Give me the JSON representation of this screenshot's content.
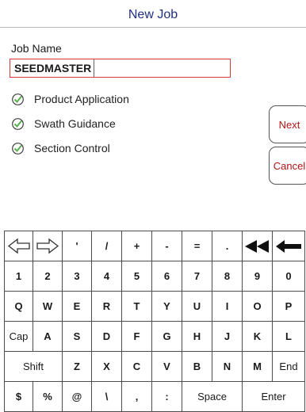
{
  "header": {
    "title": "New Job"
  },
  "form": {
    "job_name_label": "Job Name",
    "job_name_value": "SEEDMASTER",
    "options": [
      "Product Application",
      "Swath Guidance",
      "Section Control"
    ]
  },
  "buttons": {
    "next": "Next",
    "cancel": "Cancel"
  },
  "keyboard": {
    "rows": [
      [
        "left-arrow-icon",
        "right-arrow-icon",
        "'",
        "/",
        "+",
        "-",
        "=",
        ".",
        "double-backspace-icon",
        "backspace-icon"
      ],
      [
        "1",
        "2",
        "3",
        "4",
        "5",
        "6",
        "7",
        "8",
        "9",
        "0"
      ],
      [
        "Q",
        "W",
        "E",
        "R",
        "T",
        "Y",
        "U",
        "I",
        "O",
        "P"
      ],
      [
        "Cap",
        "A",
        "S",
        "D",
        "F",
        "G",
        "H",
        "J",
        "K",
        "L"
      ],
      [
        "Shift",
        "Z",
        "X",
        "C",
        "V",
        "B",
        "N",
        "M",
        "End"
      ],
      [
        "$",
        "%",
        "@",
        "\\",
        ",",
        ":",
        "Space",
        "Enter"
      ]
    ]
  },
  "colors": {
    "title": "#1f2e80",
    "accent": "#b01414",
    "check": "#58b34c"
  },
  "icons": {
    "check": "check-circle-icon",
    "left": "left-arrow-icon",
    "right": "right-arrow-icon",
    "double_back": "double-backspace-icon",
    "back": "backspace-icon"
  }
}
